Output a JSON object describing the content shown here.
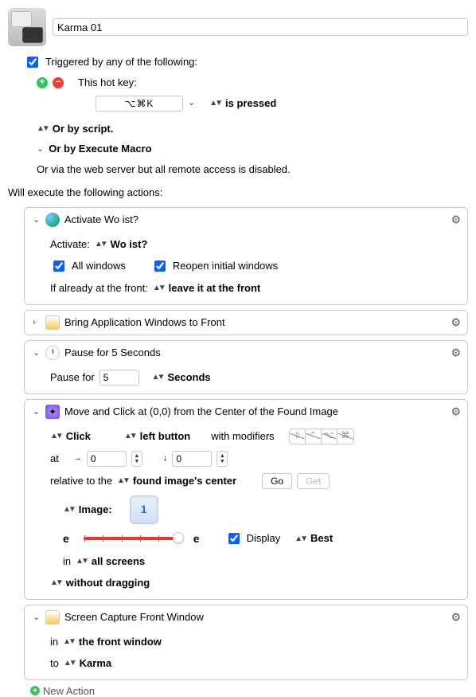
{
  "macro": {
    "name": "Karma 01"
  },
  "triggers": {
    "heading": "Triggered by any of the following:",
    "hotkey_label": "This hot key:",
    "hotkey_value": "⌥⌘K",
    "hotkey_state": "is pressed",
    "or_script": "Or by script.",
    "or_exec_macro": "Or by Execute Macro",
    "or_webserver": "Or via the web server but all remote access is disabled."
  },
  "exec_heading": "Will execute the following actions:",
  "actions": {
    "activate": {
      "title": "Activate Wo ist?",
      "activate_label": "Activate:",
      "app_name": "Wo ist?",
      "all_windows": "All windows",
      "reopen": "Reopen initial windows",
      "front_label": "If already at the front:",
      "front_value": "leave it at the front"
    },
    "bring_front": {
      "title": "Bring Application Windows to Front"
    },
    "pause": {
      "title": "Pause for 5 Seconds",
      "label": "Pause for",
      "value": "5",
      "unit": "Seconds"
    },
    "click": {
      "title": "Move and Click at (0,0) from the Center of the Found Image",
      "action": "Click",
      "button": "left button",
      "mods_label": "with modifiers",
      "at_label": "at",
      "x": "0",
      "y": "0",
      "rel_label": "relative to the",
      "rel_value": "found image's center",
      "go": "Go",
      "get": "Get",
      "image_label": "Image:",
      "image_badge": "1",
      "e1": "e",
      "e2": "e",
      "display": "Display",
      "best": "Best",
      "in_label": "in",
      "in_value": "all screens",
      "drag_value": "without dragging"
    },
    "capture": {
      "title": "Screen Capture Front Window",
      "in_label": "in",
      "in_value": "the front window",
      "to_label": "to",
      "to_value": "Karma"
    }
  },
  "new_action": "New Action"
}
